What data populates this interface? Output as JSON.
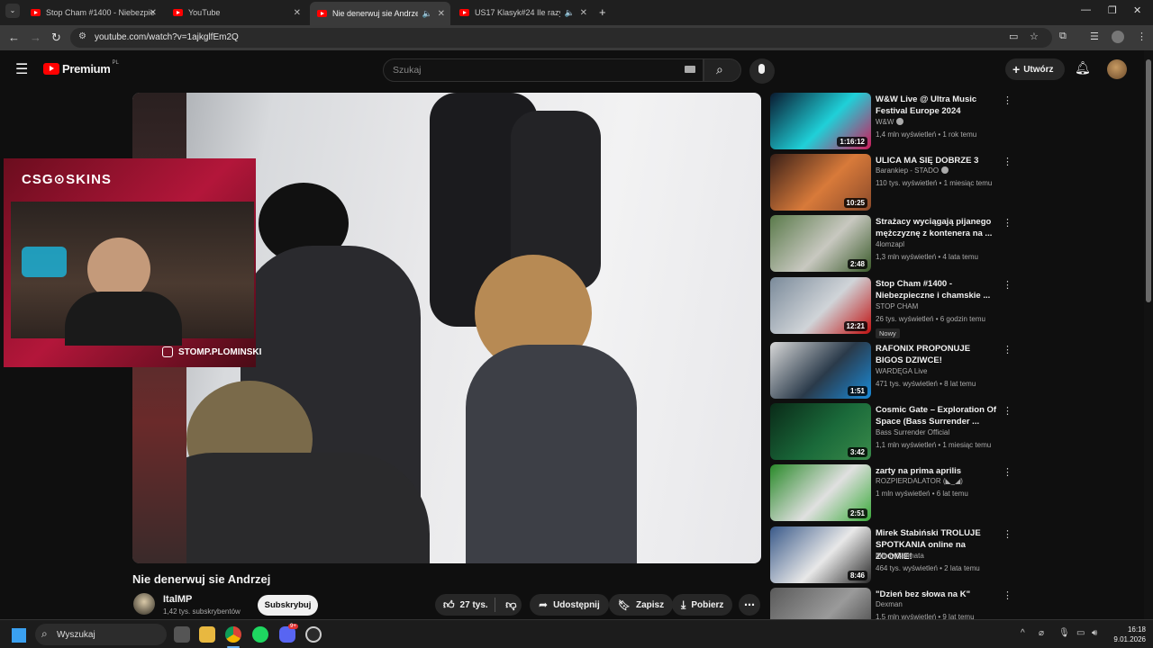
{
  "browser": {
    "tabs": [
      {
        "label": "Stop Cham #1400 - Niebezpiec",
        "active": false
      },
      {
        "label": "YouTube",
        "active": false
      },
      {
        "label": "Nie denerwuj sie Andrzej -",
        "active": true
      },
      {
        "label": "US17 Klasyk#24 Ile razy się",
        "active": false
      }
    ],
    "url": "youtube.com/watch?v=1ajkglfEm2Q"
  },
  "youtube": {
    "logo_text": "Premium",
    "region": "PL",
    "search_placeholder": "Szukaj",
    "create_label": "Utwórz"
  },
  "overlay": {
    "brand": "CSG⊙SKINS",
    "handle": "STOMP.PLOMINSKI"
  },
  "video": {
    "title": "Nie denerwuj sie Andrzej",
    "channel": "ItalMP",
    "subscribers": "1,42 tys. subskrybentów",
    "subscribe_label": "Subskrybuj",
    "likes": "27 tys.",
    "share_label": "Udostępnij",
    "save_label": "Zapisz",
    "download_label": "Pobierz"
  },
  "recommendations": [
    {
      "title": "W&W Live @ Ultra Music Festival Europe 2024",
      "channel": "W&W",
      "verified": true,
      "meta": "1,4 mln wyświetleń • 1 rok temu",
      "duration": "1:16:12",
      "thumb_colors": [
        "#0a1a30",
        "#1fd0d8",
        "#d01a5a"
      ]
    },
    {
      "title": "ULICA MA SIĘ DOBRZE 3",
      "channel": "Barankiep - STADO",
      "verified": true,
      "meta": "110 tys. wyświetleń • 1 miesiąc temu",
      "duration": "10:25",
      "thumb_colors": [
        "#3a2018",
        "#d87a3a",
        "#8a4a2a"
      ]
    },
    {
      "title": "Strażacy wyciągają pijanego mężczyznę z kontenera na ...",
      "channel": "4lomzapl",
      "verified": false,
      "meta": "1,3 mln wyświetleń • 4 lata temu",
      "duration": "2:48",
      "thumb_colors": [
        "#5a7a4a",
        "#c8c8c0",
        "#3a5a2a"
      ]
    },
    {
      "title": "Stop Cham #1400 - Niebezpieczne i chamskie ...",
      "channel": "STOP CHAM",
      "verified": false,
      "meta": "26 tys. wyświetleń • 6 godzin temu",
      "duration": "12:21",
      "badge": "Nowy",
      "thumb_colors": [
        "#7a8a9a",
        "#d0d4d8",
        "#c01010"
      ]
    },
    {
      "title": "RAFONIX PROPONUJE BIGOS DZIWCE!",
      "channel": "WARDĘGA Live",
      "verified": false,
      "meta": "471 tys. wyświetleń • 8 lat temu",
      "duration": "1:51",
      "thumb_colors": [
        "#d8d8d8",
        "#2a3a4a",
        "#1a8ad8"
      ]
    },
    {
      "title": "Cosmic Gate – Exploration Of Space (Bass Surrender ...",
      "channel": "Bass Surrender Official",
      "verified": false,
      "meta": "1,1 mln wyświetleń • 1 miesiąc temu",
      "duration": "3:42",
      "thumb_colors": [
        "#0a2a18",
        "#1a6a3a",
        "#3a8a4a"
      ]
    },
    {
      "title": "zarty na prima aprilis",
      "channel": "ROZPIERDALATOR (◣_◢)",
      "verified": false,
      "meta": "1 mln wyświetleń • 6 lat temu",
      "duration": "2:51",
      "thumb_colors": [
        "#2a8a2a",
        "#e0e0e0",
        "#3aaa3a"
      ]
    },
    {
      "title": "Mirek Stabiński TROLUJE SPOTKANIA online na ZOOMIE!",
      "channel": "Młody Sarmata",
      "verified": false,
      "meta": "464 tys. wyświetleń • 2 lata temu",
      "duration": "8:46",
      "thumb_colors": [
        "#3a5a8a",
        "#e8e8e8",
        "#2a2a2a"
      ]
    },
    {
      "title": "\"Dzień bez słowa na K\"",
      "channel": "Dexman",
      "verified": false,
      "meta": "1,5 mln wyświetleń • 9 lat temu",
      "duration": "",
      "thumb_colors": [
        "#5a5a5a",
        "#9a9a9a",
        "#3a3a3a"
      ]
    }
  ],
  "taskbar": {
    "search_label": "Wyszukaj",
    "time": "16:18",
    "date": "9.01.2026",
    "discord_badge": "9+"
  }
}
